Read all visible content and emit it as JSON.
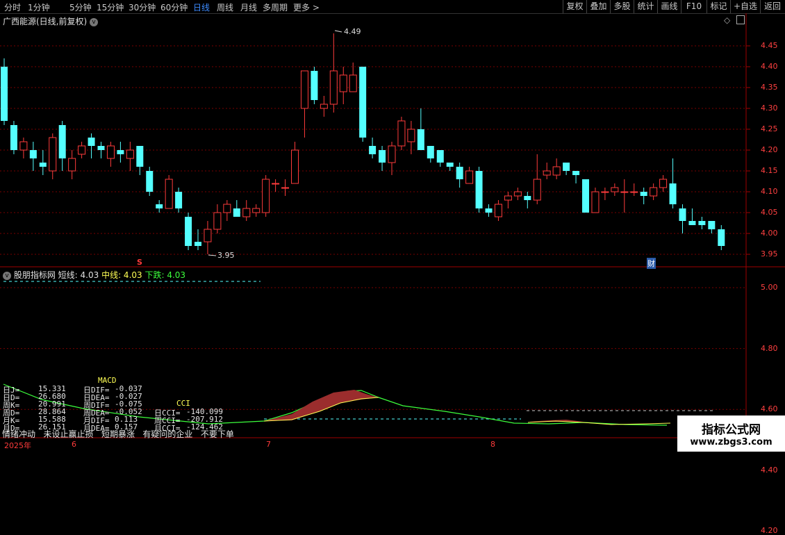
{
  "timeframes": [
    "分时",
    "1分钟",
    "5分钟",
    "15分钟",
    "30分钟",
    "60分钟",
    "日线",
    "周线",
    "月线",
    "多周期",
    "更多 >"
  ],
  "active_timeframe": "日线",
  "toolbar_buttons": [
    "复权",
    "叠加",
    "多股",
    "统计",
    "画线",
    "F10",
    "标记",
    "+自选",
    "返回"
  ],
  "stock_title": "广西能源(日线,前复权)",
  "price_axis": [
    "4.45",
    "4.40",
    "4.35",
    "4.30",
    "4.25",
    "4.20",
    "4.15",
    "4.10",
    "4.05",
    "4.00",
    "3.95"
  ],
  "high_label": "4.49",
  "low_label": "3.95",
  "marker_s": "S",
  "marker_cai": "财",
  "indicator": {
    "name": "股朋指标网",
    "short_label": "短线: 4.03",
    "mid_label": "中线: 4.03",
    "down_label": "下跌: 4.03"
  },
  "lower_axis": [
    "5.00",
    "4.80",
    "4.60",
    "4.40",
    "4.20"
  ],
  "stats": {
    "macd_title": "MACD",
    "cci_title": "CCI",
    "rows": [
      [
        "日J=",
        "15.331",
        "日DIF=",
        "-0.037",
        "",
        ""
      ],
      [
        "日D=",
        "26.680",
        "日DEA=",
        "-0.027",
        "",
        ""
      ],
      [
        "周K=",
        "20.991",
        "周DIF=",
        "-0.075",
        "CCI",
        ""
      ],
      [
        "周D=",
        "28.864",
        "周DEA=",
        "-0.052",
        "日CCI=",
        "-140.099"
      ],
      [
        "月K=",
        "15.588",
        "月DIF=",
        "0.113",
        "周CCI=",
        "-207.912"
      ],
      [
        "月D=",
        "26.151",
        "月DEA=",
        "0.157",
        "月CCI=",
        "-124.462"
      ]
    ]
  },
  "status_labels": [
    "情绪冲动",
    "未设止赢止损",
    "短期暴涨",
    "有疑问的企业",
    "不要下单"
  ],
  "date_labels": [
    "2025年",
    "6",
    "7",
    "8"
  ],
  "watermark": {
    "line1": "指标公式网",
    "line2": "www.zbgs3.com"
  },
  "colors": {
    "up": "#ff3b3b",
    "down": "#54ffff",
    "bg": "#000000",
    "grid": "#7a0000"
  },
  "candles": [
    [
      4.4,
      4.27,
      4.42,
      4.26
    ],
    [
      4.26,
      4.2,
      4.27,
      4.19
    ],
    [
      4.2,
      4.22,
      4.23,
      4.18
    ],
    [
      4.2,
      4.18,
      4.22,
      4.15
    ],
    [
      4.17,
      4.16,
      4.2,
      4.14
    ],
    [
      4.15,
      4.23,
      4.24,
      4.13
    ],
    [
      4.26,
      4.18,
      4.27,
      4.15
    ],
    [
      4.15,
      4.18,
      4.2,
      4.13
    ],
    [
      4.19,
      4.21,
      4.22,
      4.18
    ],
    [
      4.23,
      4.21,
      4.24,
      4.18
    ],
    [
      4.21,
      4.2,
      4.22,
      4.18
    ],
    [
      4.18,
      4.21,
      4.22,
      4.16
    ],
    [
      4.2,
      4.19,
      4.22,
      4.17
    ],
    [
      4.18,
      4.2,
      4.22,
      4.15
    ],
    [
      4.21,
      4.16,
      4.21,
      4.14
    ],
    [
      4.15,
      4.1,
      4.16,
      4.09
    ],
    [
      4.07,
      4.06,
      4.08,
      4.05
    ],
    [
      4.06,
      4.13,
      4.14,
      4.06
    ],
    [
      4.1,
      4.06,
      4.11,
      4.05
    ],
    [
      4.04,
      3.97,
      4.05,
      3.96
    ],
    [
      3.98,
      3.97,
      4.01,
      3.96
    ],
    [
      3.98,
      4.01,
      4.03,
      3.95
    ],
    [
      4.01,
      4.05,
      4.07,
      4.0
    ],
    [
      4.05,
      4.07,
      4.08,
      4.03
    ],
    [
      4.06,
      4.04,
      4.08,
      4.04
    ],
    [
      4.04,
      4.06,
      4.08,
      4.03
    ],
    [
      4.05,
      4.06,
      4.07,
      4.04
    ],
    [
      4.05,
      4.13,
      4.14,
      4.04
    ],
    [
      4.12,
      4.12,
      4.13,
      4.1
    ],
    [
      4.11,
      4.11,
      4.13,
      4.09
    ],
    [
      4.12,
      4.2,
      4.22,
      4.12
    ],
    [
      4.3,
      4.39,
      4.39,
      4.23
    ],
    [
      4.39,
      4.32,
      4.4,
      4.31
    ],
    [
      4.3,
      4.31,
      4.33,
      4.28
    ],
    [
      4.31,
      4.39,
      4.48,
      4.29
    ],
    [
      4.34,
      4.38,
      4.4,
      4.31
    ],
    [
      4.34,
      4.38,
      4.41,
      4.34
    ],
    [
      4.4,
      4.23,
      4.4,
      4.22
    ],
    [
      4.21,
      4.19,
      4.23,
      4.18
    ],
    [
      4.2,
      4.17,
      4.21,
      4.15
    ],
    [
      4.17,
      4.21,
      4.22,
      4.14
    ],
    [
      4.21,
      4.27,
      4.28,
      4.2
    ],
    [
      4.22,
      4.25,
      4.27,
      4.19
    ],
    [
      4.25,
      4.2,
      4.3,
      4.2
    ],
    [
      4.21,
      4.18,
      4.21,
      4.17
    ],
    [
      4.2,
      4.17,
      4.2,
      4.16
    ],
    [
      4.17,
      4.16,
      4.17,
      4.15
    ],
    [
      4.16,
      4.13,
      4.17,
      4.11
    ],
    [
      4.12,
      4.15,
      4.16,
      4.12
    ],
    [
      4.15,
      4.06,
      4.16,
      4.05
    ],
    [
      4.06,
      4.05,
      4.07,
      4.04
    ],
    [
      4.04,
      4.07,
      4.08,
      4.03
    ],
    [
      4.08,
      4.09,
      4.1,
      4.06
    ],
    [
      4.09,
      4.1,
      4.11,
      4.08
    ],
    [
      4.09,
      4.08,
      4.1,
      4.06
    ],
    [
      4.08,
      4.13,
      4.19,
      4.07
    ],
    [
      4.14,
      4.15,
      4.17,
      4.13
    ],
    [
      4.14,
      4.16,
      4.18,
      4.13
    ],
    [
      4.17,
      4.15,
      4.17,
      4.14
    ],
    [
      4.15,
      4.14,
      4.15,
      4.12
    ],
    [
      4.13,
      4.05,
      4.13,
      4.05
    ],
    [
      4.05,
      4.1,
      4.11,
      4.05
    ],
    [
      4.1,
      4.1,
      4.11,
      4.08
    ],
    [
      4.1,
      4.11,
      4.12,
      4.09
    ],
    [
      4.1,
      4.1,
      4.13,
      4.05
    ],
    [
      4.1,
      4.1,
      4.12,
      4.09
    ],
    [
      4.1,
      4.09,
      4.11,
      4.07
    ],
    [
      4.09,
      4.11,
      4.12,
      4.08
    ],
    [
      4.11,
      4.13,
      4.14,
      4.1
    ],
    [
      4.12,
      4.07,
      4.18,
      4.06
    ],
    [
      4.06,
      4.03,
      4.07,
      4.0
    ],
    [
      4.03,
      4.02,
      4.06,
      4.02
    ],
    [
      4.03,
      4.02,
      4.04,
      4.01
    ],
    [
      4.03,
      4.01,
      4.03,
      4.0
    ],
    [
      4.01,
      3.97,
      4.02,
      3.96
    ]
  ]
}
